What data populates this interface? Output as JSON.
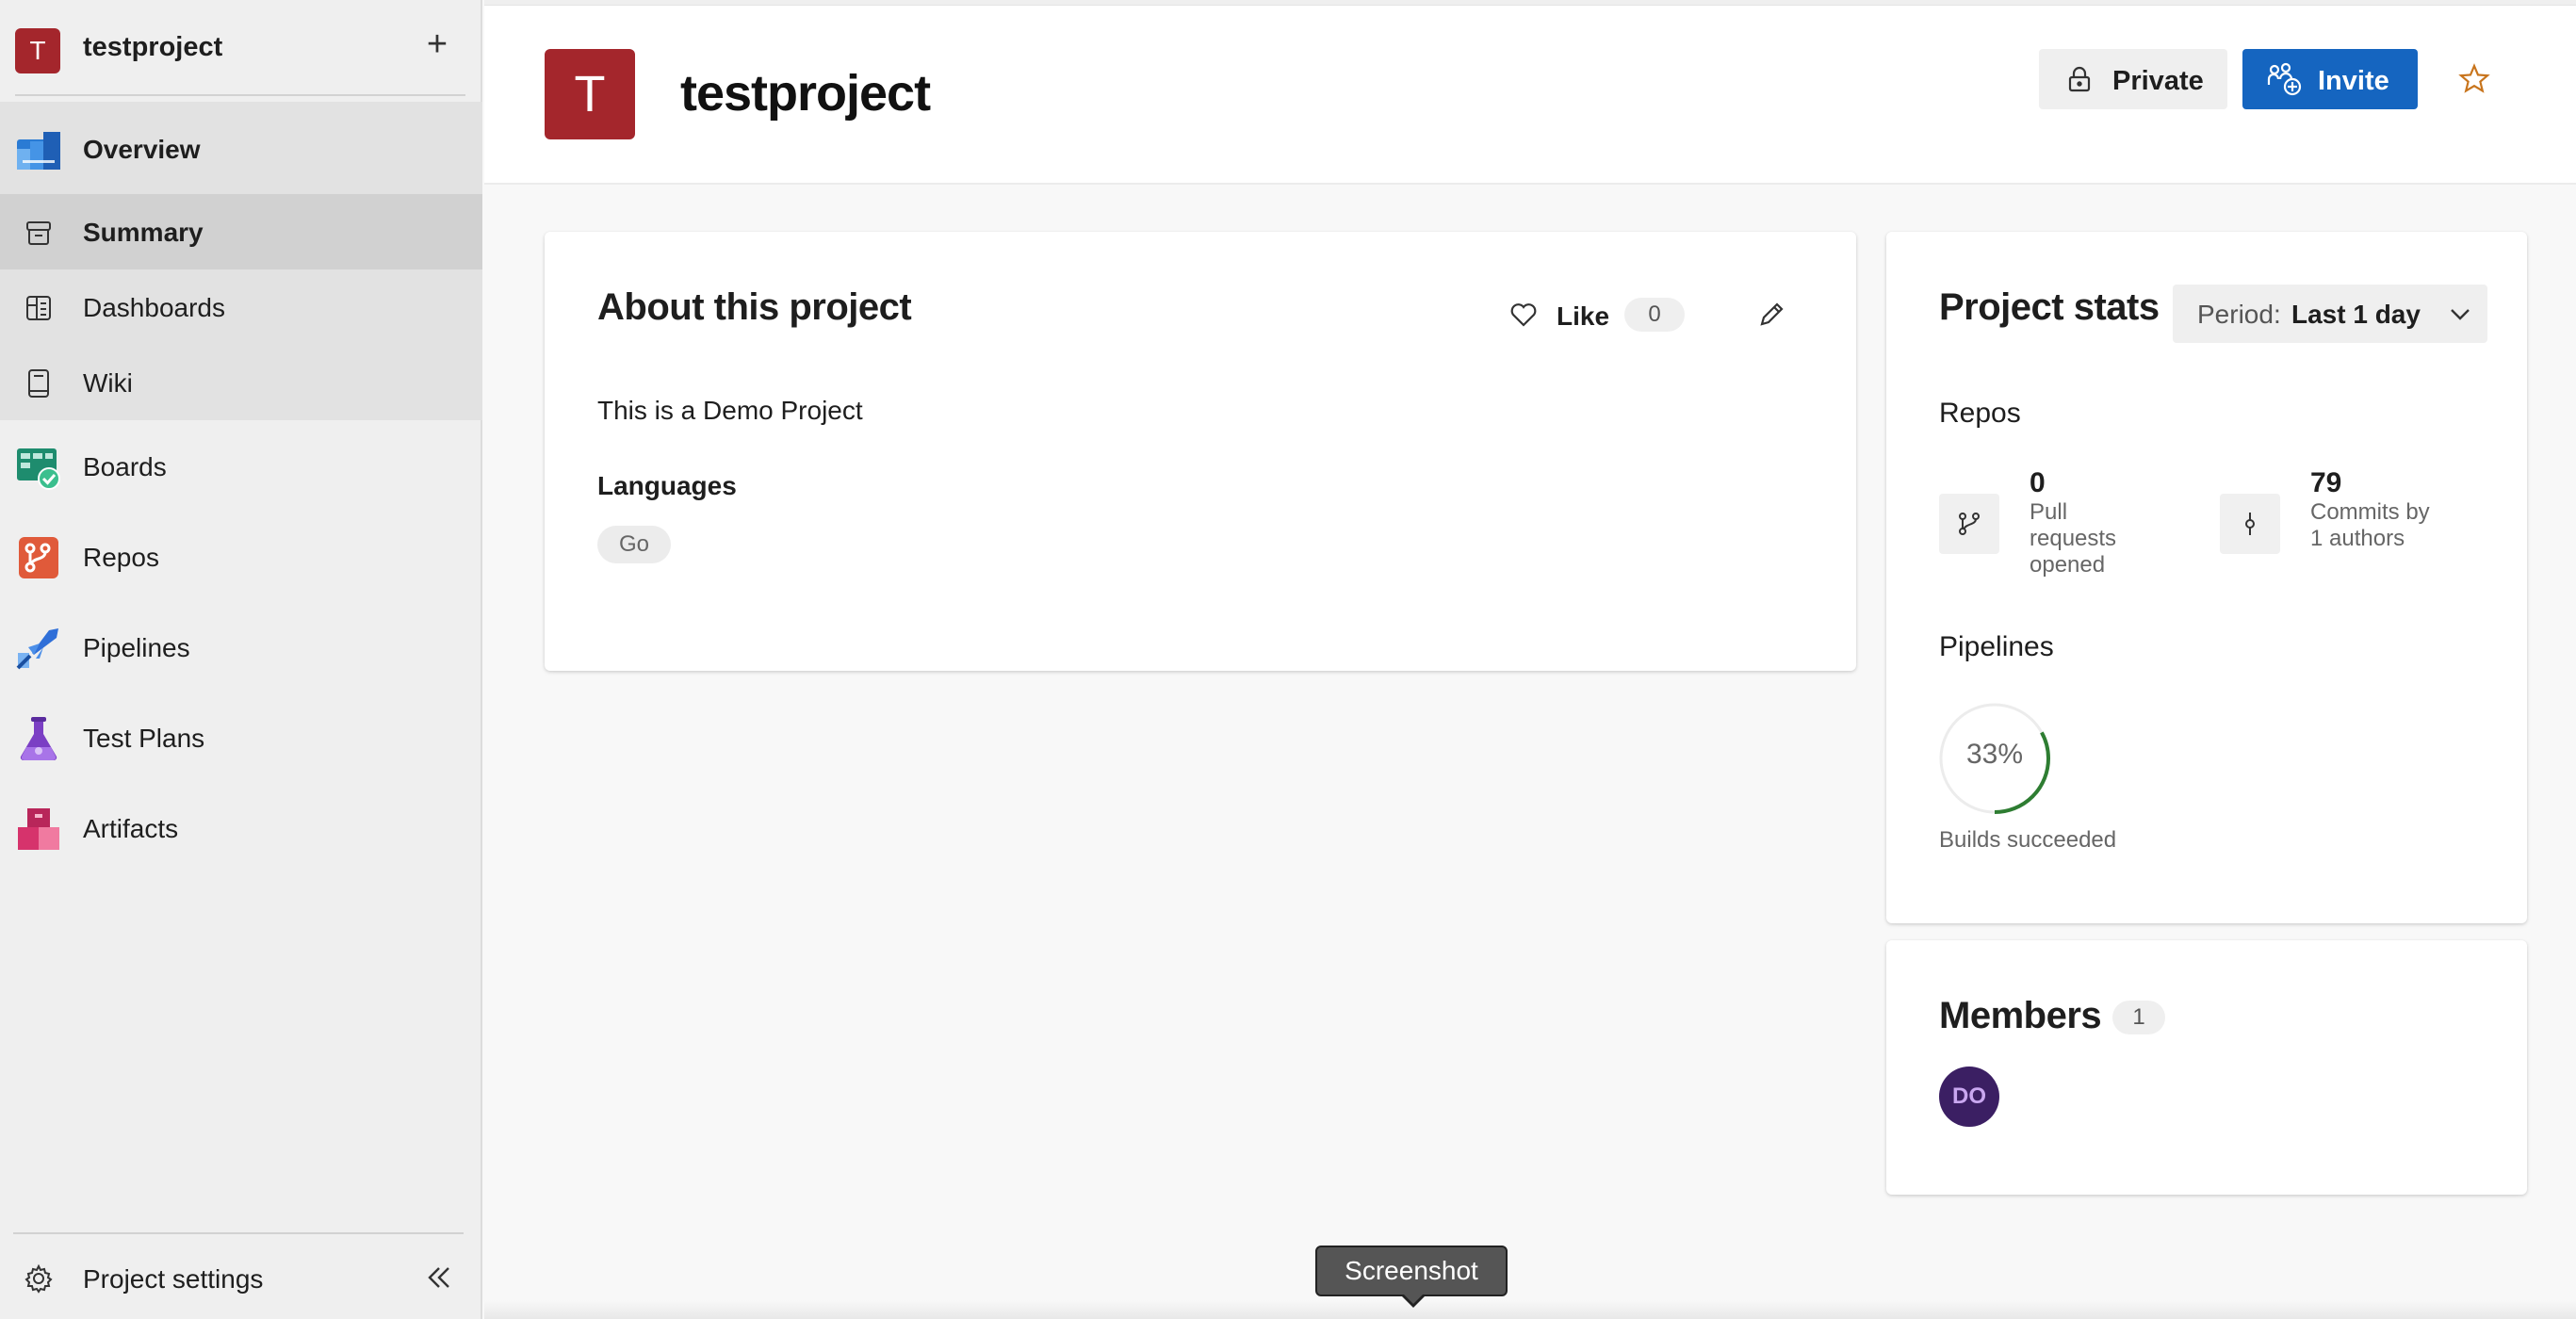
{
  "sidebar": {
    "project_initial": "T",
    "project_name": "testproject",
    "add_icon": "plus-icon",
    "items": [
      {
        "label": "Overview",
        "icon": "overview-icon"
      },
      {
        "label": "Summary",
        "icon": "summary-icon"
      },
      {
        "label": "Dashboards",
        "icon": "dashboards-icon"
      },
      {
        "label": "Wiki",
        "icon": "wiki-icon"
      },
      {
        "label": "Boards",
        "icon": "boards-icon"
      },
      {
        "label": "Repos",
        "icon": "repos-icon"
      },
      {
        "label": "Pipelines",
        "icon": "pipelines-icon"
      },
      {
        "label": "Test Plans",
        "icon": "test-plans-icon"
      },
      {
        "label": "Artifacts",
        "icon": "artifacts-icon"
      }
    ],
    "settings_label": "Project settings",
    "collapse_icon": "double-chevron-left-icon"
  },
  "header": {
    "project_initial": "T",
    "project_title": "testproject",
    "private_label": "Private",
    "invite_label": "Invite",
    "favorite_icon": "star-icon"
  },
  "about": {
    "title": "About this project",
    "like_label": "Like",
    "like_count": "0",
    "description": "This is a Demo Project",
    "languages_label": "Languages",
    "languages": [
      "Go"
    ]
  },
  "stats": {
    "title": "Project stats",
    "period_label": "Period:",
    "period_value": "Last 1 day",
    "repos_label": "Repos",
    "pull_requests_count": "0",
    "pull_requests_text": "Pull requests opened",
    "commits_count": "79",
    "commits_text": "Commits by 1 authors",
    "pipelines_label": "Pipelines",
    "builds_percent_text": "33%",
    "builds_fraction": 0.33,
    "builds_caption": "Builds succeeded"
  },
  "members": {
    "title": "Members",
    "count": "1",
    "avatars": [
      "DO"
    ]
  },
  "tooltip": {
    "text": "Screenshot"
  },
  "colors": {
    "project_red": "#a4262c",
    "invite_blue": "#1565c0",
    "success_green": "#2e7d32",
    "star_orange": "#c8741c"
  }
}
